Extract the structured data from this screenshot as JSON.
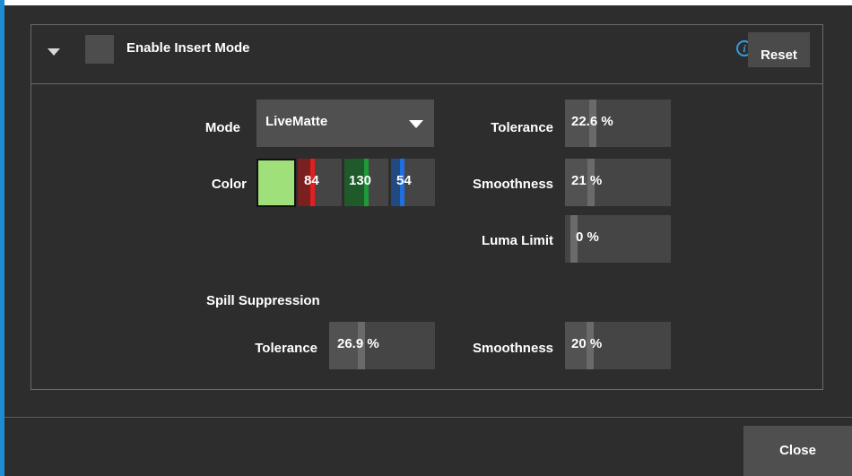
{
  "header": {
    "enable_label": "Enable Insert Mode",
    "reset_label": "Reset",
    "info_icon": "info-icon"
  },
  "mode": {
    "label": "Mode",
    "selected": "LiveMatte"
  },
  "color": {
    "label": "Color",
    "swatch_color": "#a0e07a",
    "red": "84",
    "green": "130",
    "blue": "54",
    "red_color": "#e02020",
    "green_color": "#1e9a3a",
    "blue_color": "#1f6fe0"
  },
  "key": {
    "tolerance": {
      "label": "Tolerance",
      "value": "22.6 %",
      "level": 0.226
    },
    "smoothness": {
      "label": "Smoothness",
      "value": "21 %",
      "level": 0.21
    },
    "luma_limit": {
      "label": "Luma Limit",
      "value": "0 %",
      "level": 0.0
    }
  },
  "spill": {
    "title": "Spill Suppression",
    "tolerance": {
      "label": "Tolerance",
      "value": "26.9 %",
      "level": 0.269
    },
    "smoothness": {
      "label": "Smoothness",
      "value": "20 %",
      "level": 0.2
    }
  },
  "footer": {
    "close_label": "Close"
  }
}
